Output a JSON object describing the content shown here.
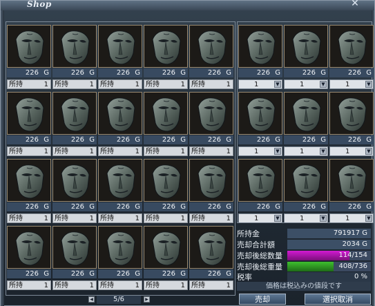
{
  "window": {
    "title": "Shop",
    "close_glyph": "✕"
  },
  "grid": {
    "left_slots": [
      {
        "price": "226",
        "currency": "G",
        "owned_label": "所持",
        "owned": "1"
      },
      {
        "price": "226",
        "currency": "G",
        "owned_label": "所持",
        "owned": "1"
      },
      {
        "price": "226",
        "currency": "G",
        "owned_label": "所持",
        "owned": "1"
      },
      {
        "price": "226",
        "currency": "G",
        "owned_label": "所持",
        "owned": "1"
      },
      {
        "price": "226",
        "currency": "G",
        "owned_label": "所持",
        "owned": "1"
      },
      {
        "price": "226",
        "currency": "G",
        "owned_label": "所持",
        "owned": "1"
      },
      {
        "price": "226",
        "currency": "G",
        "owned_label": "所持",
        "owned": "1"
      },
      {
        "price": "226",
        "currency": "G",
        "owned_label": "所持",
        "owned": "1"
      },
      {
        "price": "226",
        "currency": "G",
        "owned_label": "所持",
        "owned": "1"
      },
      {
        "price": "226",
        "currency": "G",
        "owned_label": "所持",
        "owned": "1"
      },
      {
        "price": "226",
        "currency": "G",
        "owned_label": "所持",
        "owned": "1"
      },
      {
        "price": "226",
        "currency": "G",
        "owned_label": "所持",
        "owned": "1"
      },
      {
        "price": "226",
        "currency": "G",
        "owned_label": "所持",
        "owned": "1"
      },
      {
        "price": "226",
        "currency": "G",
        "owned_label": "所持",
        "owned": "1"
      },
      {
        "price": "226",
        "currency": "G",
        "owned_label": "所持",
        "owned": "1"
      },
      {
        "price": "226",
        "currency": "G",
        "owned_label": "所持",
        "owned": "1"
      },
      {
        "price": "226",
        "currency": "G",
        "owned_label": "所持",
        "owned": "1"
      },
      {
        "price": "226",
        "currency": "G",
        "owned_label": "所持",
        "owned": "1"
      },
      {
        "price": "226",
        "currency": "G",
        "owned_label": "所持",
        "owned": "1"
      },
      {
        "price": "226",
        "currency": "G",
        "owned_label": "所持",
        "owned": "1"
      }
    ],
    "right_slots": [
      {
        "price": "226",
        "currency": "G",
        "sell_qty": "1"
      },
      {
        "price": "226",
        "currency": "G",
        "sell_qty": "1"
      },
      {
        "price": "226",
        "currency": "G",
        "sell_qty": "1"
      },
      {
        "price": "226",
        "currency": "G",
        "sell_qty": "1"
      },
      {
        "price": "226",
        "currency": "G",
        "sell_qty": "1"
      },
      {
        "price": "226",
        "currency": "G",
        "sell_qty": "1"
      },
      {
        "price": "226",
        "currency": "G",
        "sell_qty": "1"
      },
      {
        "price": "226",
        "currency": "G",
        "sell_qty": "1"
      },
      {
        "price": "226",
        "currency": "G",
        "sell_qty": "1"
      }
    ],
    "item_icon": "stone-mask-icon"
  },
  "info": {
    "money_label": "所持金",
    "money_value": "791917 G",
    "total_label": "売却合計額",
    "total_value": "2034 G",
    "count_label": "売却後総数量",
    "count_value": "114/154",
    "count_fraction": 0.74,
    "count_color": "#d21ad2",
    "weight_label": "売却後総重量",
    "weight_value": "408/736",
    "weight_fraction": 0.554,
    "weight_color": "#3ec02e",
    "tax_label": "税率",
    "tax_value": "0 %",
    "tax_note": "価格は税込みの値段です"
  },
  "pager": {
    "text": "5/6",
    "prev_glyph": "◀",
    "next_glyph": "▶"
  },
  "buttons": {
    "sell": "売却",
    "cancel": "選択取消"
  }
}
